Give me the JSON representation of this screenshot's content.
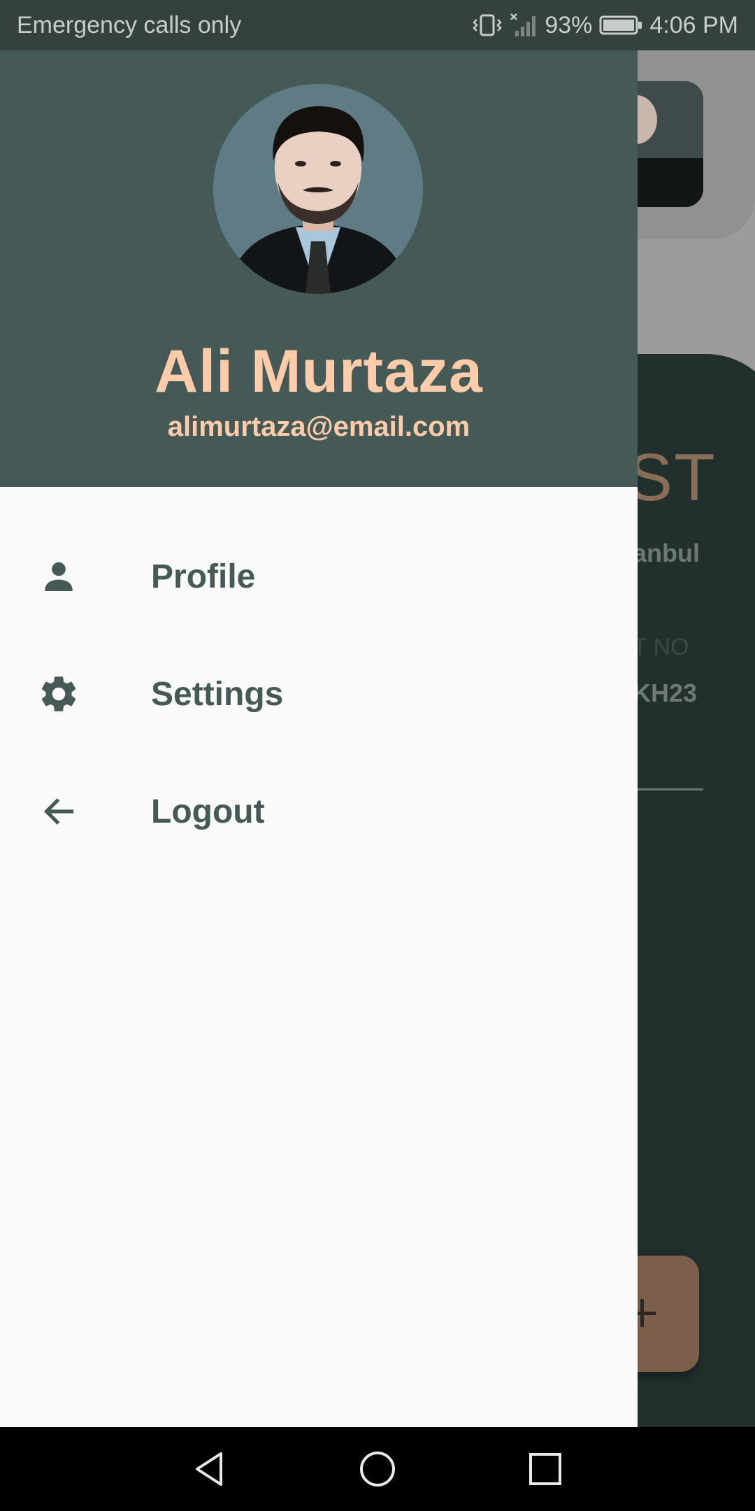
{
  "status_bar": {
    "carrier_text": "Emergency calls only",
    "battery": "93%",
    "time": "4:06 PM",
    "icons": [
      "vibrate-icon",
      "no-signal-icon",
      "battery-icon"
    ]
  },
  "background_screen": {
    "big_text": "ST",
    "city_text": "anbul",
    "label_text": "T NO",
    "code_text": "KH23",
    "fab_icon": "plus-icon"
  },
  "drawer": {
    "header": {
      "name": "Ali Murtaza",
      "email": "alimurtaza@email.com"
    },
    "menu": [
      {
        "label": "Profile",
        "icon": "person-icon"
      },
      {
        "label": "Settings",
        "icon": "gear-icon"
      },
      {
        "label": "Logout",
        "icon": "arrow-left-icon"
      }
    ]
  },
  "nav_bar": {
    "buttons": [
      "back-icon",
      "home-icon",
      "recents-icon"
    ]
  },
  "colors": {
    "header_bg": "#455a57",
    "accent_text": "#ffccaa",
    "menu_text": "#455a57",
    "drawer_bg": "#fafafa"
  }
}
